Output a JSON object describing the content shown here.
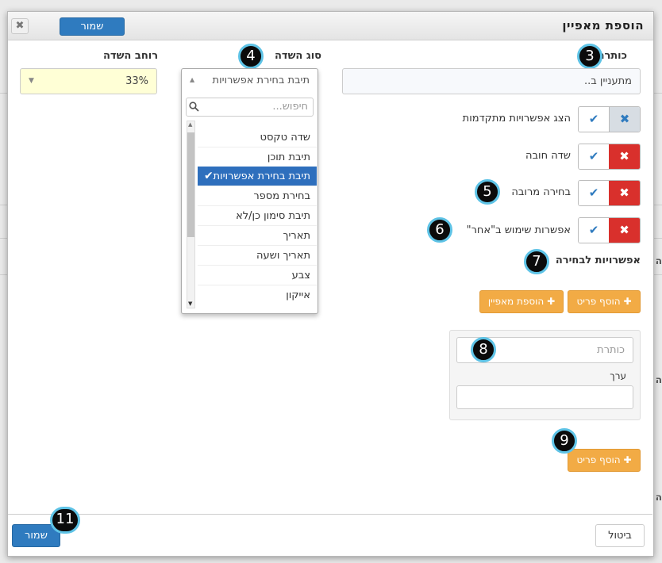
{
  "background": {
    "right_chars": [
      "ה",
      "ה",
      "ה",
      "ה"
    ]
  },
  "modal": {
    "title": "הוספת  מאפיין",
    "close_icon": "✖",
    "header_save": "שמור",
    "footer_save": "שמור",
    "cancel": "ביטול"
  },
  "fields": {
    "title_label": "כותרת",
    "title_value": "מתעניין ב..",
    "type_label": "סוג השדה",
    "width_label": "רוחב השדה",
    "width_value": "33%"
  },
  "dropdown": {
    "selected": "תיבת בחירת אפשרויות",
    "search_placeholder": "חיפוש...",
    "options": [
      "שדה טקסט",
      "תיבת תוכן",
      "תיבת בחירת אפשרויות",
      "בחירת מספר",
      "תיבת סימון כן/לא",
      "תאריך",
      "תאריך ושעה",
      "צבע",
      "אייקון"
    ],
    "selected_index": 2
  },
  "toggles": [
    {
      "label": "הצג אפשרויות מתקדמות",
      "state": "off-gray"
    },
    {
      "label": "שדה חובה",
      "state": "off-red"
    },
    {
      "label": "בחירה מרובה",
      "state": "off-red"
    },
    {
      "label": "אפשרות שימוש ב\"אחר\"",
      "state": "off-red"
    }
  ],
  "options_section": {
    "label": "אפשרויות לבחירה",
    "add_item": "הוסף פריט",
    "add_property": "הוספת מאפיין",
    "item_title_placeholder": "כותרת",
    "value_label": "ערך",
    "add_item_bottom": "הוסף פריט"
  },
  "badges": [
    "3",
    "4",
    "5",
    "6",
    "7",
    "8",
    "9",
    "11"
  ],
  "colors": {
    "primary": "#2f7bbf",
    "danger": "#d9302c",
    "warning": "#f2ab45",
    "badge_ring": "#5ec3e6",
    "width_field_bg": "#ffffd6"
  }
}
